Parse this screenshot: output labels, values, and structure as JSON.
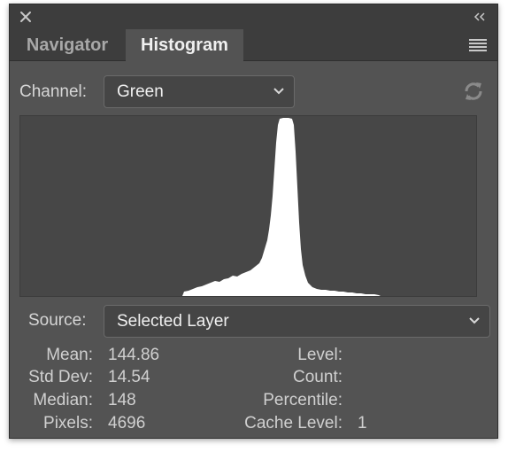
{
  "tabs": [
    {
      "label": "Navigator",
      "active": false
    },
    {
      "label": "Histogram",
      "active": true
    }
  ],
  "channel": {
    "label": "Channel:",
    "value": "Green"
  },
  "source": {
    "label": "Source:",
    "value": "Selected Layer"
  },
  "stats_left": [
    {
      "label": "Mean:",
      "value": "144.86"
    },
    {
      "label": "Std Dev:",
      "value": "14.54"
    },
    {
      "label": "Median:",
      "value": "148"
    },
    {
      "label": "Pixels:",
      "value": "4696"
    }
  ],
  "stats_right": [
    {
      "label": "Level:",
      "value": ""
    },
    {
      "label": "Count:",
      "value": ""
    },
    {
      "label": "Percentile:",
      "value": ""
    },
    {
      "label": "Cache Level:",
      "value": "1"
    }
  ],
  "icons": {
    "close": "close-icon",
    "collapse": "double-chevron-left-icon",
    "menu": "hamburger-menu-icon",
    "dropdown": "chevron-down-icon",
    "refresh": "refresh-icon"
  },
  "colors": {
    "panel": "#535353",
    "histogram_bg": "#474747",
    "histogram_fill": "#ffffff"
  }
}
